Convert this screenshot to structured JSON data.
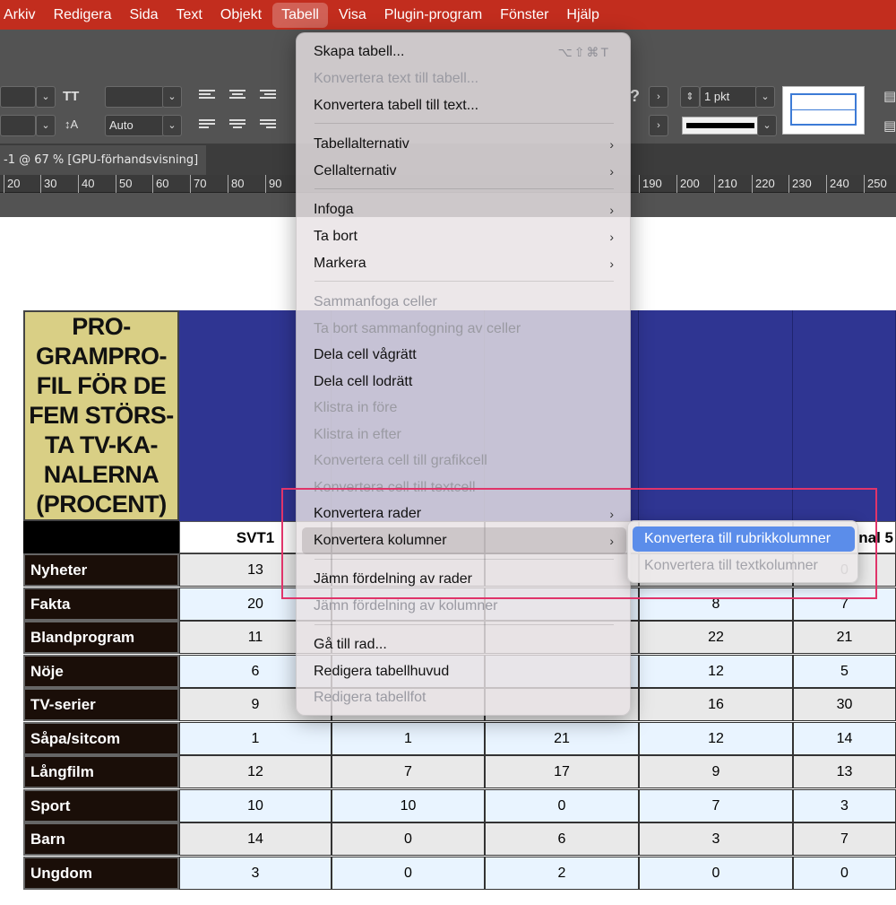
{
  "menubar": {
    "items": [
      "Arkiv",
      "Redigera",
      "Sida",
      "Text",
      "Objekt",
      "Tabell",
      "Visa",
      "Plugin-program",
      "Fönster",
      "Hjälp"
    ],
    "active": "Tabell"
  },
  "control_panel": {
    "tracking_value": "",
    "leading_value": "Auto",
    "stroke_weight": "1 pkt",
    "font_size_icon": "font-size-icon",
    "leading_icon": "leading-icon"
  },
  "document_tab": {
    "title": "-1 @ 67 % [GPU-förhandsvisning]"
  },
  "ruler": {
    "labels": [
      "20",
      "30",
      "40",
      "50",
      "60",
      "70",
      "80",
      "90",
      "190",
      "200",
      "210",
      "220",
      "230",
      "240",
      "250"
    ]
  },
  "table": {
    "title": "PRO-\nGRAMPRO-\nFIL FÖR DE\nFEM STÖRS-\nTA TV-KA-\nNALERNA\n(PROCENT)",
    "columns": [
      "SVT1",
      "",
      "",
      "",
      "nal 5"
    ],
    "rows": [
      {
        "label": "Nyheter",
        "values": [
          "13",
          "",
          "",
          "",
          "0"
        ]
      },
      {
        "label": "Fakta",
        "values": [
          "20",
          "",
          "",
          "8",
          "7"
        ]
      },
      {
        "label": "Blandprogram",
        "values": [
          "11",
          "",
          "",
          "22",
          "21"
        ]
      },
      {
        "label": "Nöje",
        "values": [
          "6",
          "",
          "",
          "12",
          "5"
        ]
      },
      {
        "label": "TV-serier",
        "values": [
          "9",
          "",
          "",
          "16",
          "30"
        ]
      },
      {
        "label": "Såpa/sitcom",
        "values": [
          "1",
          "1",
          "21",
          "12",
          "14"
        ]
      },
      {
        "label": "Långfilm",
        "values": [
          "12",
          "7",
          "17",
          "9",
          "13"
        ]
      },
      {
        "label": "Sport",
        "values": [
          "10",
          "10",
          "0",
          "7",
          "3"
        ]
      },
      {
        "label": "Barn",
        "values": [
          "14",
          "0",
          "6",
          "3",
          "7"
        ]
      },
      {
        "label": "Ungdom",
        "values": [
          "3",
          "0",
          "2",
          "0",
          "0"
        ]
      }
    ]
  },
  "menu": {
    "items": [
      {
        "label": "Skapa tabell...",
        "shortcut": "⌥⇧⌘T",
        "enabled": true
      },
      {
        "label": "Konvertera text till tabell...",
        "enabled": false
      },
      {
        "label": "Konvertera tabell till text...",
        "enabled": true
      },
      {
        "label": "Tabellalternativ",
        "submenu": true,
        "enabled": true
      },
      {
        "label": "Cellalternativ",
        "submenu": true,
        "enabled": true
      },
      {
        "label": "Infoga",
        "submenu": true,
        "enabled": true
      },
      {
        "label": "Ta bort",
        "submenu": true,
        "enabled": true
      },
      {
        "label": "Markera",
        "submenu": true,
        "enabled": true
      },
      {
        "label": "Sammanfoga celler",
        "enabled": false
      },
      {
        "label": "Ta bort sammanfogning av celler",
        "enabled": false
      },
      {
        "label": "Dela cell vågrätt",
        "enabled": true
      },
      {
        "label": "Dela cell lodrätt",
        "enabled": true
      },
      {
        "label": "Klistra in före",
        "enabled": false
      },
      {
        "label": "Klistra in efter",
        "enabled": false
      },
      {
        "label": "Konvertera cell till grafikcell",
        "enabled": false
      },
      {
        "label": "Konvertera cell till textcell",
        "enabled": false
      },
      {
        "label": "Konvertera rader",
        "submenu": true,
        "enabled": true
      },
      {
        "label": "Konvertera kolumner",
        "submenu": true,
        "enabled": true,
        "selected": true
      },
      {
        "label": "Jämn fördelning av rader",
        "enabled": true
      },
      {
        "label": "Jämn fördelning av kolumner",
        "enabled": false
      },
      {
        "label": "Gå till rad...",
        "enabled": true
      },
      {
        "label": "Redigera tabellhuvud",
        "enabled": true
      },
      {
        "label": "Redigera tabellfot",
        "enabled": false
      }
    ]
  },
  "submenu": {
    "items": [
      {
        "label": "Konvertera till rubrikkolumner",
        "enabled": true,
        "highlighted": true
      },
      {
        "label": "Konvertera till textkolumner",
        "enabled": false
      }
    ]
  },
  "colors": {
    "menubar": "#c22d1e",
    "header_blue": "#2f3592",
    "title_cell": "#d9cf85",
    "highlight_frame": "#e0346a",
    "submenu_highlight": "#5b8dea"
  }
}
